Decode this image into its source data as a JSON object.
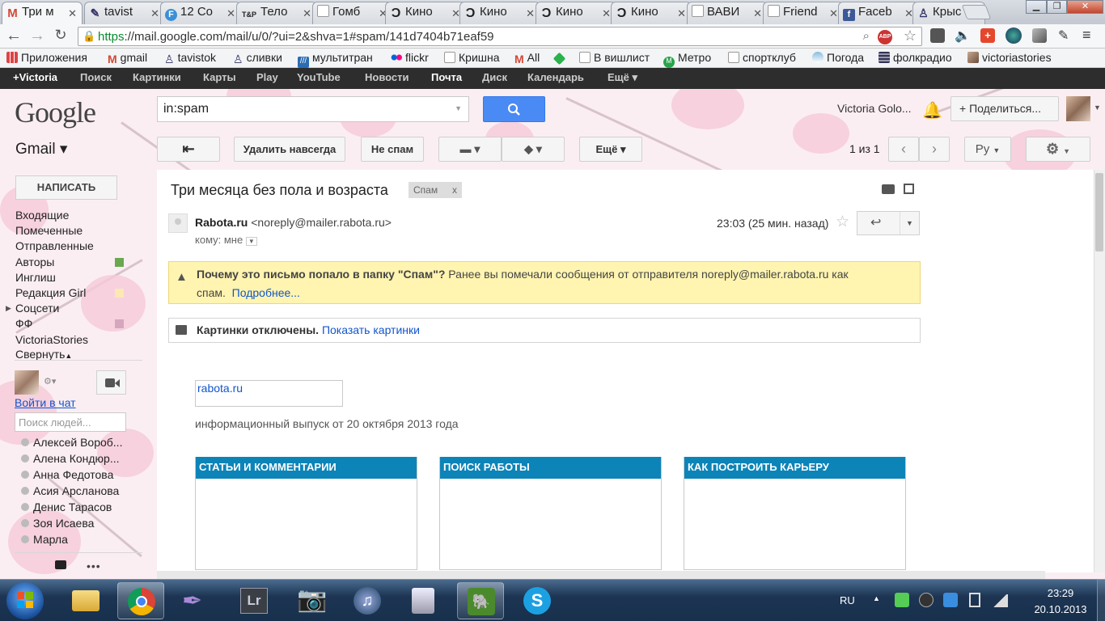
{
  "browser": {
    "tabs": [
      {
        "label": "Три м",
        "icon": "gmail-icon"
      },
      {
        "label": "tavist",
        "icon": "livejournal-icon"
      },
      {
        "label": "12 Co",
        "icon": "f-icon"
      },
      {
        "label": "Тело",
        "icon": "tnp-icon"
      },
      {
        "label": "Гомб",
        "icon": "page-icon"
      },
      {
        "label": "Кино",
        "icon": "kinopoisk-icon"
      },
      {
        "label": "Кино",
        "icon": "kinopoisk-icon"
      },
      {
        "label": "Кино",
        "icon": "kinopoisk-icon"
      },
      {
        "label": "Кино",
        "icon": "kinopoisk-icon"
      },
      {
        "label": "ВАВИ",
        "icon": "page-icon"
      },
      {
        "label": "Friend",
        "icon": "page-icon"
      },
      {
        "label": "Faceb",
        "icon": "facebook-icon"
      },
      {
        "label": "Крыс",
        "icon": "livejournal-icon"
      }
    ],
    "url": "https://mail.google.com/mail/u/0/?ui=2&shva=1#spam/141d7404b71eaf59",
    "url_scheme": "https",
    "url_rest": "://mail.google.com/mail/u/0/?ui=2&shva=1#spam/141d7404b71eaf59",
    "bookmarks": [
      "Приложения",
      "gmail",
      "tavistok",
      "сливки",
      "мультитран",
      "flickr",
      "Кришна",
      "All",
      "В вишлист",
      "Метро",
      "спортклуб",
      "Погода",
      "фолкрадио",
      "victoriastories"
    ]
  },
  "google_bar": {
    "items": [
      "+Victoria",
      "Поиск",
      "Картинки",
      "Карты",
      "Play",
      "YouTube",
      "Новости",
      "Почта",
      "Диск",
      "Календарь",
      "Ещё ▾"
    ],
    "selected": "Почта"
  },
  "header": {
    "logo": "Google",
    "search_value": "in:spam",
    "user_name": "Victoria Golo...",
    "share_label": "Поделиться..."
  },
  "toolbar": {
    "app_label": "Gmail ▾",
    "delete_forever": "Удалить навсегда",
    "not_spam": "Не спам",
    "more": "Ещё ▾",
    "pager": "1 из 1",
    "lang": "Ру"
  },
  "sidebar": {
    "compose": "НАПИСАТЬ",
    "items": [
      {
        "label": "Входящие"
      },
      {
        "label": "Помеченные"
      },
      {
        "label": "Отправленные"
      },
      {
        "label": "Авторы",
        "color": "#6aa84f"
      },
      {
        "label": "Инглиш"
      },
      {
        "label": "Редакция Girl",
        "color": "#fce8b3"
      },
      {
        "label": "Соцсети"
      },
      {
        "label": "ФФ",
        "color": "#d5a6bd"
      },
      {
        "label": "VictoriaStories"
      },
      {
        "label": "Свернуть"
      }
    ],
    "chat_signin": "Войти в чат",
    "people_placeholder": "Поиск людей...",
    "contacts": [
      "Алексей Вороб...",
      "Алена Кондюр...",
      "Анна Федотова",
      "Асия Арсланова",
      "Денис Тарасов",
      "Зоя Исаева",
      "Марла"
    ]
  },
  "message": {
    "subject": "Три месяца без пола и возраста",
    "label": "Спам",
    "sender_name": "Rabota.ru",
    "sender_email": "<noreply@mailer.rabota.ru>",
    "recipient": "кому: мне",
    "time": "23:03 (25 мин. назад)",
    "spam_reason_bold": "Почему это письмо попало в папку \"Спам\"?",
    "spam_reason_text": " Ранее вы помечали сообщения от отправителя noreply@mailer.rabota.ru как спам.",
    "spam_more_link": "Подробнее...",
    "images_off_bold": "Картинки отключены.",
    "images_show_link": "Показать картинки",
    "body_logo_alt": "rabota.ru",
    "issue_line": "информационный выпуск от 20 октября 2013 года",
    "columns": [
      "СТАТЬИ И КОММЕНТАРИИ",
      "ПОИСК РАБОТЫ",
      "КАК ПОСТРОИТЬ КАРЬЕРУ"
    ]
  },
  "taskbar": {
    "lang": "RU",
    "time": "23:29",
    "date": "20.10.2013",
    "apps": [
      "windows-explorer-icon",
      "chrome-icon",
      "pen-icon",
      "lightroom-icon",
      "camera-icon",
      "itunes-icon",
      "calculator-icon",
      "evernote-icon",
      "skype-icon"
    ]
  },
  "colors": {
    "accent_blue": "#4a8af4",
    "column_header": "#0d84b8",
    "spam_banner": "#fff4b0"
  }
}
